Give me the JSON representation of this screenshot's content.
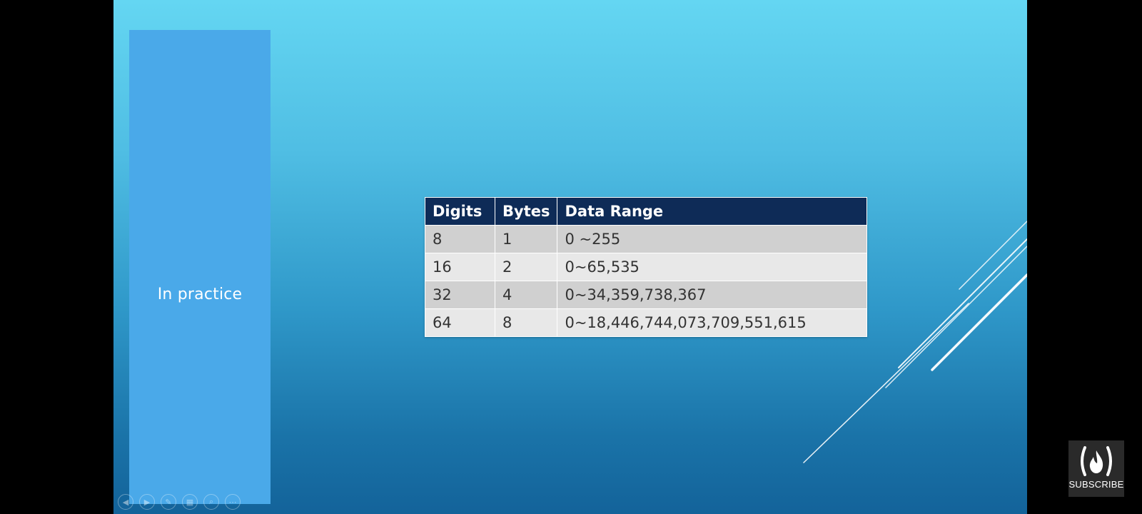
{
  "slide": {
    "side_title": "In practice"
  },
  "table": {
    "headers": [
      "Digits",
      "Bytes",
      "Data Range"
    ],
    "rows": [
      [
        "8",
        "1",
        "0 ~255"
      ],
      [
        "16",
        "2",
        "0~65,535"
      ],
      [
        "32",
        "4",
        "0~34,359,738,367"
      ],
      [
        "64",
        "8",
        "0~18,446,744,073,709,551,615"
      ]
    ]
  },
  "colors": {
    "header_bg": "#0e2b57",
    "row_odd": "#d0d0d0",
    "row_even": "#e8e8e8",
    "side_panel": "#4aa9e9"
  },
  "nav_controls": {
    "icons": [
      "prev-icon",
      "next-icon",
      "pen-icon",
      "slides-icon",
      "zoom-icon",
      "more-icon"
    ],
    "glyphs": [
      "◀",
      "▶",
      "✎",
      "▦",
      "⌕",
      "⋯"
    ]
  },
  "subscribe": {
    "label": "SUBSCRIBE",
    "icon": "freecodecamp-flame-icon"
  }
}
